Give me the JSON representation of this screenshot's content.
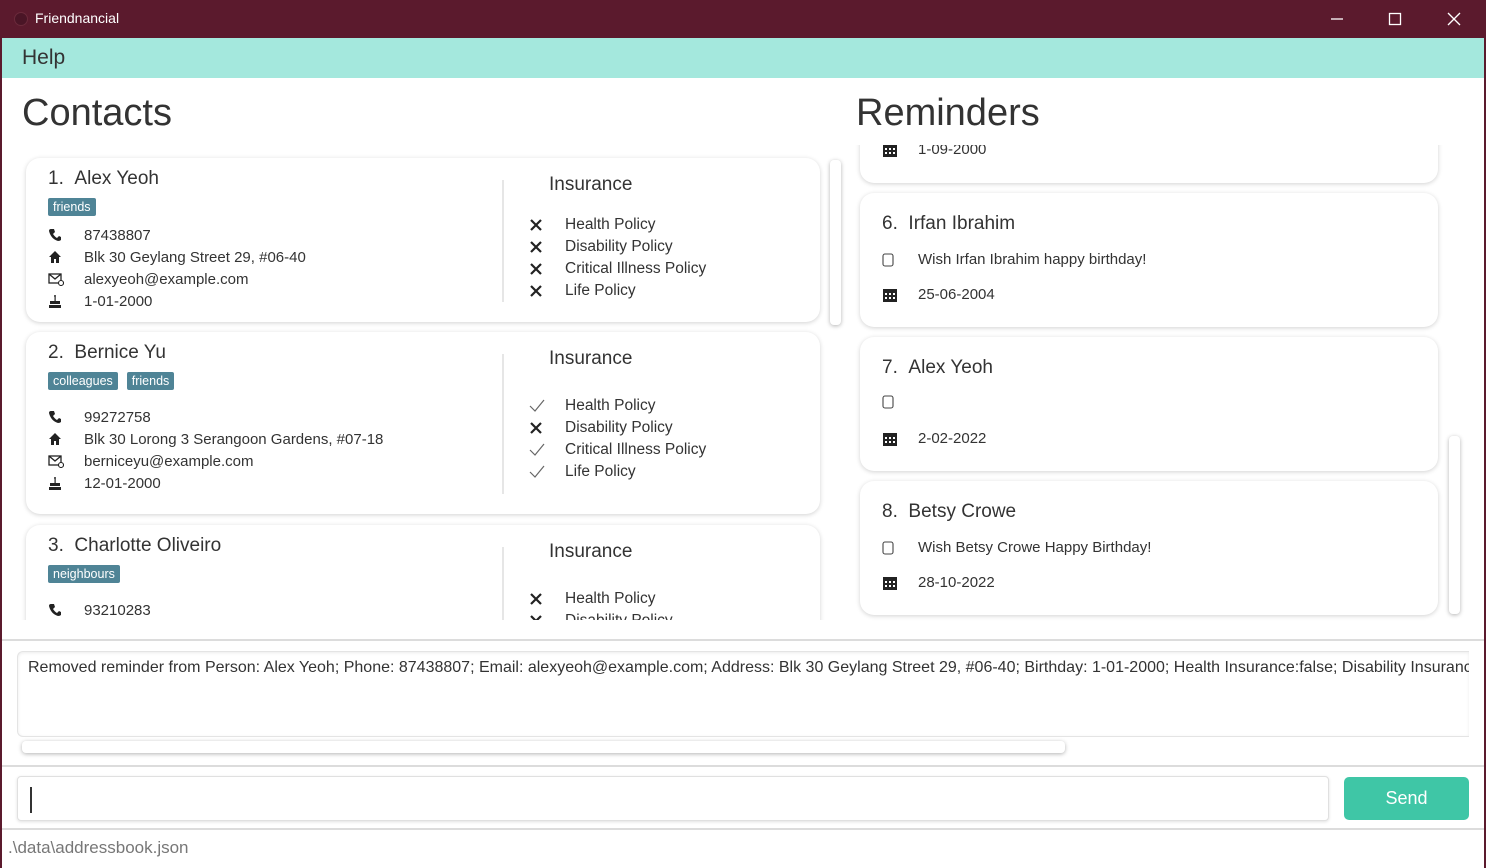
{
  "window": {
    "title": "Friendnancial"
  },
  "menu": {
    "help": "Help"
  },
  "contacts": {
    "title": "Contacts",
    "insurance_title": "Insurance",
    "items": [
      {
        "index": "1.",
        "name": "Alex Yeoh",
        "tags": [
          "friends"
        ],
        "phone": "87438807",
        "address": "Blk 30 Geylang Street 29, #06-40",
        "email": "alexyeoh@example.com",
        "birthday": "1-01-2000",
        "policies": [
          {
            "label": "Health Policy",
            "covered": false
          },
          {
            "label": "Disability Policy",
            "covered": false
          },
          {
            "label": "Critical Illness Policy",
            "covered": false
          },
          {
            "label": "Life Policy",
            "covered": false
          }
        ]
      },
      {
        "index": "2.",
        "name": "Bernice Yu",
        "tags": [
          "colleagues",
          "friends"
        ],
        "phone": "99272758",
        "address": "Blk 30 Lorong 3 Serangoon Gardens, #07-18",
        "email": "berniceyu@example.com",
        "birthday": "12-01-2000",
        "policies": [
          {
            "label": "Health Policy",
            "covered": true
          },
          {
            "label": "Disability Policy",
            "covered": false
          },
          {
            "label": "Critical Illness Policy",
            "covered": true
          },
          {
            "label": "Life Policy",
            "covered": true
          }
        ]
      },
      {
        "index": "3.",
        "name": "Charlotte Oliveiro",
        "tags": [
          "neighbours"
        ],
        "phone": "93210283",
        "policies": [
          {
            "label": "Health Policy",
            "covered": false
          },
          {
            "label": "Disability Policy",
            "covered": false
          }
        ]
      }
    ]
  },
  "reminders": {
    "title": "Reminders",
    "partial_date": "1-09-2000",
    "items": [
      {
        "index": "6.",
        "name": "Irfan Ibrahim",
        "description": "Wish Irfan Ibrahim happy birthday!",
        "date": "25-06-2004"
      },
      {
        "index": "7.",
        "name": "Alex Yeoh",
        "description": "",
        "date": "2-02-2022"
      },
      {
        "index": "8.",
        "name": "Betsy Crowe",
        "description": "Wish Betsy Crowe Happy Birthday!",
        "date": "28-10-2022"
      }
    ]
  },
  "result": {
    "text": "Removed reminder from Person: Alex Yeoh; Phone: 87438807; Email: alexyeoh@example.com; Address: Blk 30 Geylang Street 29, #06-40; Birthday: 1-01-2000; Health Insurance:false; Disability Insurance:false"
  },
  "command": {
    "value": "",
    "send_label": "Send"
  },
  "status": {
    "path": ".\\data\\addressbook.json"
  },
  "colors": {
    "titlebar": "#5b1a2d",
    "menubar": "#a4e8dd",
    "tag": "#4f8496",
    "send": "#3fc6a6"
  }
}
